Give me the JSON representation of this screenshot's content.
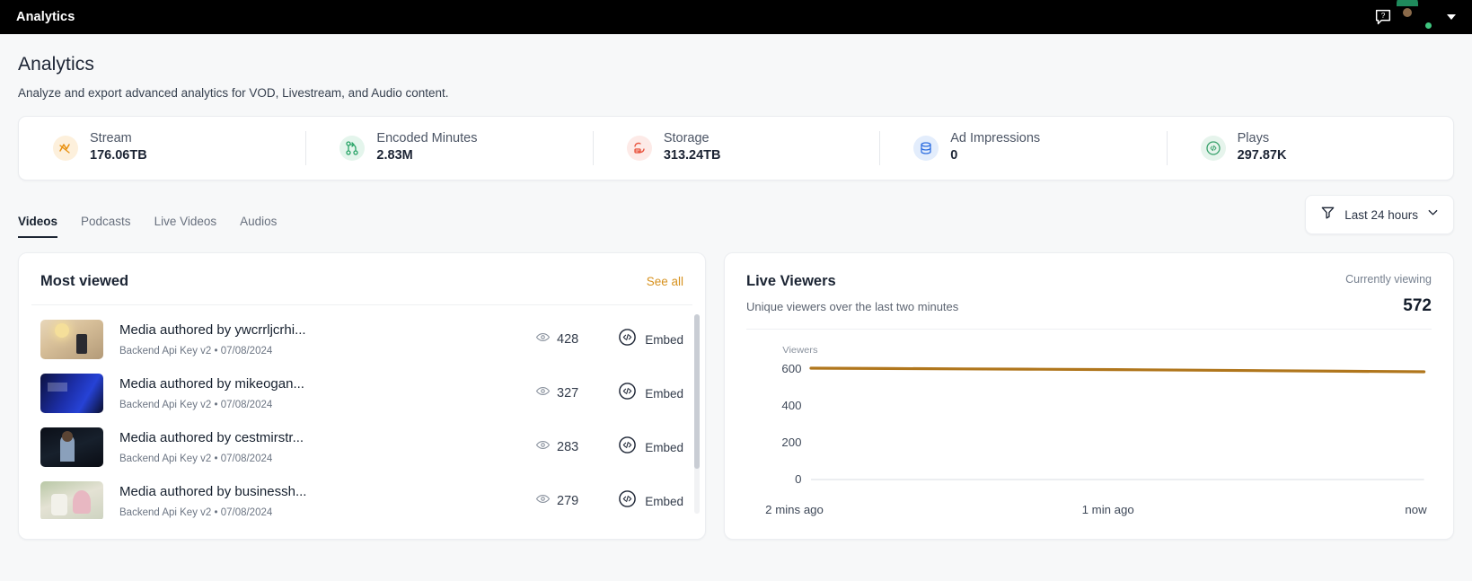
{
  "topbar": {
    "title": "Analytics",
    "help_icon": "help-question-icon",
    "avatar_icon": "user-avatar",
    "caret_icon": "chevron-down-icon"
  },
  "page": {
    "title": "Analytics",
    "subtitle": "Analyze and export advanced analytics for VOD, Livestream, and Audio content."
  },
  "stats": [
    {
      "label": "Stream",
      "value": "176.06TB",
      "icon": "stream-icon",
      "color": "#e8900f"
    },
    {
      "label": "Encoded Minutes",
      "value": "2.83M",
      "icon": "git-branch-icon",
      "color": "#27a366"
    },
    {
      "label": "Storage",
      "value": "313.24TB",
      "icon": "storage-sync-icon",
      "color": "#e8503a"
    },
    {
      "label": "Ad Impressions",
      "value": "0",
      "icon": "database-icon",
      "color": "#2f6fe0"
    },
    {
      "label": "Plays",
      "value": "297.87K",
      "icon": "play-embed-icon",
      "color": "#37a06a"
    }
  ],
  "tabs": [
    {
      "label": "Videos",
      "active": true
    },
    {
      "label": "Podcasts",
      "active": false
    },
    {
      "label": "Live Videos",
      "active": false
    },
    {
      "label": "Audios",
      "active": false
    }
  ],
  "range_filter": {
    "label": "Last 24 hours",
    "filter_icon": "filter-funnel-icon",
    "caret_icon": "chevron-down-icon"
  },
  "most_viewed": {
    "title": "Most viewed",
    "see_all": "See all",
    "embed_label": "Embed",
    "items": [
      {
        "title": "Media authored by ywcrrljcrhi...",
        "sub": "Backend Api Key v2 • 07/08/2024",
        "views": "428"
      },
      {
        "title": "Media authored by mikeogan...",
        "sub": "Backend Api Key v2 • 07/08/2024",
        "views": "327"
      },
      {
        "title": "Media authored by cestmirstr...",
        "sub": "Backend Api Key v2 • 07/08/2024",
        "views": "283"
      },
      {
        "title": "Media authored by businessh...",
        "sub": "Backend Api Key v2 • 07/08/2024",
        "views": "279"
      }
    ]
  },
  "live_viewers": {
    "title": "Live Viewers",
    "subtitle": "Unique viewers over the last two minutes",
    "currently_viewing_label": "Currently viewing",
    "currently_viewing_value": "572"
  },
  "chart_data": {
    "type": "line",
    "title": "Live Viewers",
    "ylabel": "Viewers",
    "xlabel": "",
    "yticks": [
      "600",
      "400",
      "200",
      "0"
    ],
    "ylim": [
      0,
      600
    ],
    "xticks": [
      "2 mins ago",
      "1 min ago",
      "now"
    ],
    "grid": false,
    "line_color": "#b0761c",
    "series": [
      {
        "name": "Viewers",
        "x": [
          0,
          12,
          25,
          37,
          50,
          62,
          75,
          87,
          100
        ],
        "values": [
          597,
          596,
          595,
          594,
          593,
          592,
          590,
          589,
          588
        ]
      }
    ]
  }
}
